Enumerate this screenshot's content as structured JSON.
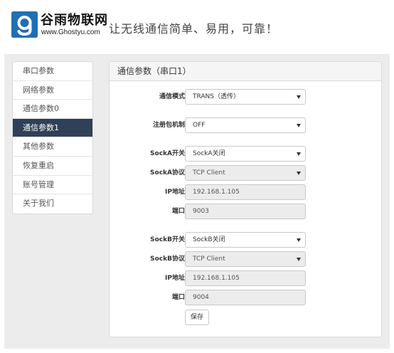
{
  "header": {
    "brand_name": "谷雨物联网",
    "brand_url": "www.Ghostyu.com",
    "slogan": "让无线通信简单、易用，可靠！",
    "logo_color": "#1f6fb5"
  },
  "sidebar": {
    "items": [
      {
        "label": "串口参数",
        "active": false
      },
      {
        "label": "网络参数",
        "active": false
      },
      {
        "label": "通信参数0",
        "active": false
      },
      {
        "label": "通信参数1",
        "active": true
      },
      {
        "label": "其他参数",
        "active": false
      },
      {
        "label": "恢复重启",
        "active": false
      },
      {
        "label": "账号管理",
        "active": false
      },
      {
        "label": "关于我们",
        "active": false
      }
    ],
    "active_color": "#2f4058"
  },
  "panel": {
    "title": "通信参数（串口1）",
    "fields": {
      "comm_mode": {
        "label": "通信模式",
        "value": "TRANS（透传）"
      },
      "register_pkg": {
        "label": "注册包机制",
        "value": "OFF"
      },
      "socka_switch": {
        "label": "SockA开关",
        "value": "SockA关闭"
      },
      "socka_protocol": {
        "label": "SockA协议",
        "value": "TCP Client"
      },
      "socka_ip": {
        "label": "IP地址",
        "value": "192.168.1.105"
      },
      "socka_port": {
        "label": "端口",
        "value": "9003"
      },
      "sockb_switch": {
        "label": "SockB开关",
        "value": "SockB关闭"
      },
      "sockb_protocol": {
        "label": "SockB协议",
        "value": "TCP Client"
      },
      "sockb_ip": {
        "label": "IP地址",
        "value": "192.168.1.105"
      },
      "sockb_port": {
        "label": "端口",
        "value": "9004"
      }
    },
    "save_label": "保存"
  }
}
